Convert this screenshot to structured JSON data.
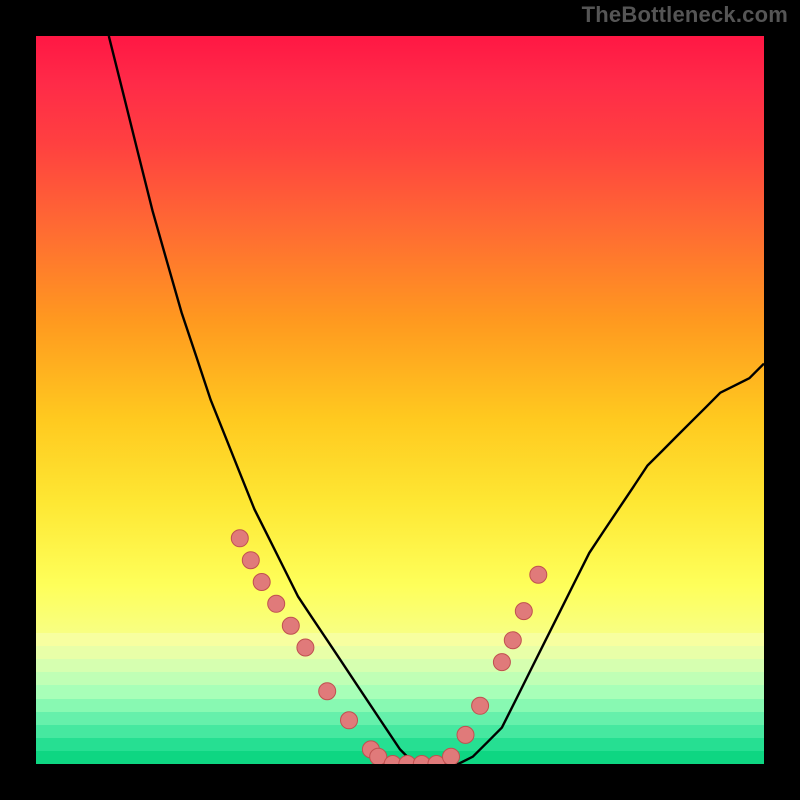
{
  "watermark": {
    "text": "TheBottleneck.com"
  },
  "colors": {
    "frame": "#000000",
    "curve": "#000000",
    "marker_fill": "#e07a7a",
    "marker_stroke": "#c05050",
    "bands": [
      "#f7ffa0",
      "#e8ffa8",
      "#d6ffb0",
      "#c0ffb5",
      "#a8ffb8",
      "#88f9b2",
      "#66f0ab",
      "#46e8a0",
      "#26df92",
      "#0ed682"
    ]
  },
  "chart_data": {
    "type": "line",
    "title": "",
    "xlabel": "",
    "ylabel": "",
    "xlim": [
      0,
      100
    ],
    "ylim": [
      0,
      100
    ],
    "note": "Bottleneck-style V-curve. Minimum ≈0% near x≈50; left arm rises steeply toward 100% as x→10; right arm rises toward ≈55% as x→100. Markers cluster on both arms between ≈15% and 30% and along the flat bottom.",
    "series": [
      {
        "name": "curve",
        "x": [
          10,
          12,
          14,
          16,
          18,
          20,
          22,
          24,
          26,
          28,
          30,
          32,
          34,
          36,
          38,
          40,
          42,
          44,
          46,
          48,
          50,
          52,
          54,
          56,
          58,
          60,
          62,
          64,
          66,
          68,
          70,
          72,
          74,
          76,
          78,
          80,
          82,
          84,
          86,
          88,
          90,
          92,
          94,
          96,
          98,
          100
        ],
        "y": [
          100,
          92,
          84,
          76,
          69,
          62,
          56,
          50,
          45,
          40,
          35,
          31,
          27,
          23,
          20,
          17,
          14,
          11,
          8,
          5,
          2,
          0,
          0,
          0,
          0,
          1,
          3,
          5,
          9,
          13,
          17,
          21,
          25,
          29,
          32,
          35,
          38,
          41,
          43,
          45,
          47,
          49,
          51,
          52,
          53,
          55
        ]
      }
    ],
    "markers": {
      "name": "points",
      "x": [
        28,
        29.5,
        31,
        33,
        35,
        37,
        40,
        43,
        46,
        47,
        49,
        51,
        53,
        55,
        57,
        59,
        61,
        64,
        65.5,
        67,
        69
      ],
      "y": [
        31,
        28,
        25,
        22,
        19,
        16,
        10,
        6,
        2,
        1,
        0,
        0,
        0,
        0,
        1,
        4,
        8,
        14,
        17,
        21,
        26
      ]
    }
  }
}
